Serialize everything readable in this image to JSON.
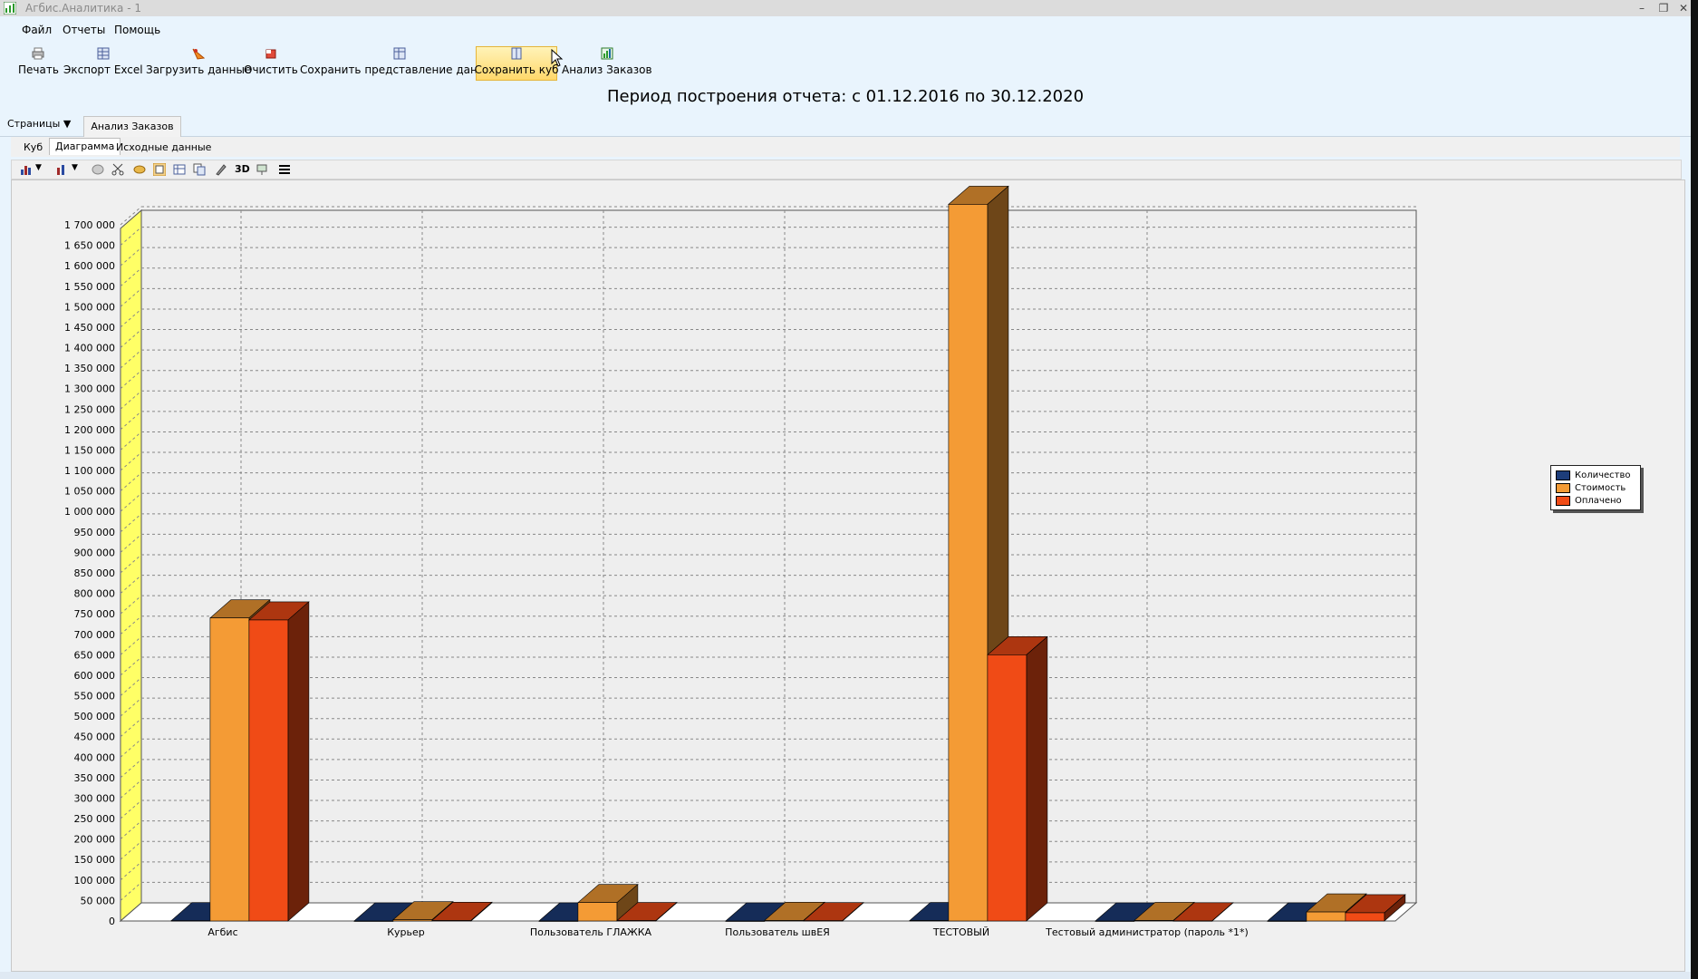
{
  "window": {
    "title": "Агбис.Аналитика - 1"
  },
  "menu": [
    "Файл",
    "Отчеты",
    "Помощь"
  ],
  "toolbar": {
    "buttons": [
      "Печать",
      "Экспорт Excel",
      "Загрузить данные",
      "Очистить",
      "Сохранить представление данных",
      "Сохранить куб",
      "Анализ Заказов"
    ]
  },
  "report": {
    "period": "Период построения отчета: с 01.12.2016 по 30.12.2020"
  },
  "pages": {
    "dropdown": "Страницы",
    "tab": "Анализ Заказов"
  },
  "subtabs": [
    "Куб",
    "Диаграмма",
    "Исходные данные"
  ],
  "chart_toolbar": {
    "label_3d": "3D"
  },
  "colors": {
    "count": "#1d3d7a",
    "cost": "#f49b35",
    "paid": "#f04b16",
    "wall": "#ffff66"
  },
  "chart_data": {
    "type": "bar",
    "style": "3d-clustered",
    "categories": [
      "Агбис",
      "Курьер",
      "Пользователь ГЛАЖКА",
      "Пользователь швЕЯ",
      "ТЕСТОВЫЙ",
      "Тестовый администратор (пароль *1*)",
      ""
    ],
    "series": [
      {
        "name": "Количество",
        "values": [
          700,
          10,
          30,
          5,
          1000,
          2,
          60
        ]
      },
      {
        "name": "Стоимость",
        "values": [
          740000,
          3000,
          45000,
          1500,
          1750000,
          1200,
          22000
        ]
      },
      {
        "name": "Оплачено",
        "values": [
          735000,
          1500,
          1000,
          800,
          650000,
          500,
          20000
        ]
      }
    ],
    "ylim": [
      0,
      1750000
    ],
    "yticks": [
      "0",
      "50 000",
      "100 000",
      "150 000",
      "200 000",
      "250 000",
      "300 000",
      "350 000",
      "400 000",
      "450 000",
      "500 000",
      "550 000",
      "600 000",
      "650 000",
      "700 000",
      "750 000",
      "800 000",
      "850 000",
      "900 000",
      "950 000",
      "1 000 000",
      "1 050 000",
      "1 100 000",
      "1 150 000",
      "1 200 000",
      "1 250 000",
      "1 300 000",
      "1 350 000",
      "1 400 000",
      "1 450 000",
      "1 500 000",
      "1 550 000",
      "1 600 000",
      "1 650 000",
      "1 700 000"
    ],
    "grid": true,
    "legend_position": "right"
  }
}
